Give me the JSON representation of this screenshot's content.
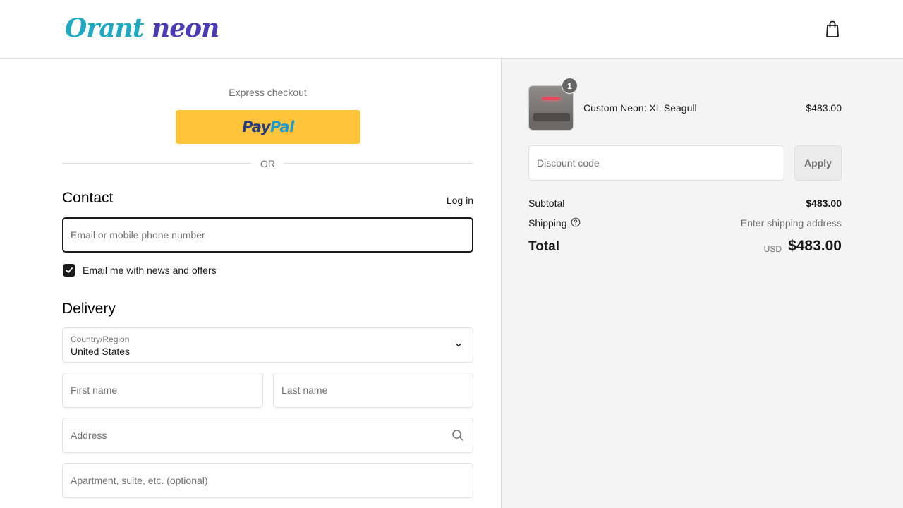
{
  "header": {
    "logo_part1": "Orant",
    "logo_part2": "neon",
    "cart_icon": "shopping-bag-icon"
  },
  "express": {
    "label": "Express checkout",
    "paypal_pay": "Pay",
    "paypal_pal": "Pal",
    "or_label": "OR"
  },
  "contact": {
    "title": "Contact",
    "login_label": "Log in",
    "email_placeholder": "Email or mobile phone number",
    "newsletter_label": "Email me with news and offers",
    "newsletter_checked": true
  },
  "delivery": {
    "title": "Delivery",
    "country_label": "Country/Region",
    "country_value": "United States",
    "first_name_placeholder": "First name",
    "last_name_placeholder": "Last name",
    "address_placeholder": "Address",
    "apartment_placeholder": "Apartment, suite, etc. (optional)"
  },
  "summary": {
    "item": {
      "quantity": "1",
      "name": "Custom Neon: XL Seagull",
      "price": "$483.00"
    },
    "discount_placeholder": "Discount code",
    "apply_label": "Apply",
    "subtotal_label": "Subtotal",
    "subtotal_value": "$483.00",
    "shipping_label": "Shipping",
    "shipping_value": "Enter shipping address",
    "total_label": "Total",
    "total_currency": "USD",
    "total_value": "$483.00"
  },
  "colors": {
    "paypal_yellow": "#ffc439",
    "logo_cyan": "#1fa9c4",
    "logo_purple": "#4b3ab5",
    "summary_background": "#f4f4f4"
  }
}
